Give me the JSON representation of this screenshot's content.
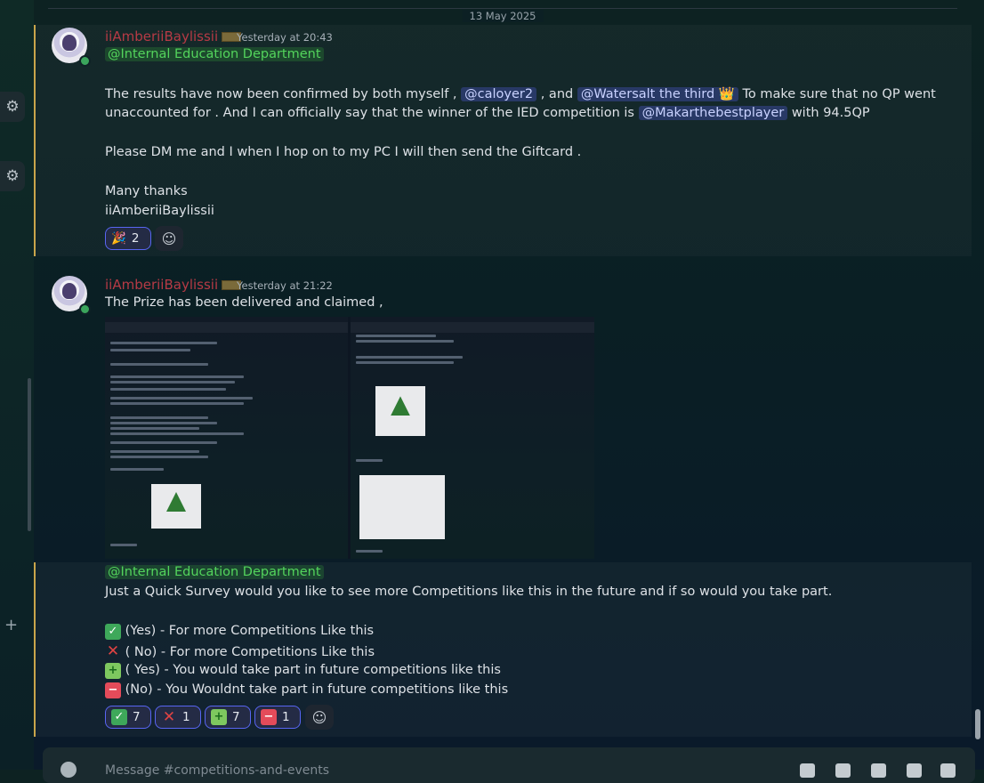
{
  "divider": {
    "date": "13 May 2025"
  },
  "message1": {
    "author": "iiAmberiiBaylissii",
    "timestamp": "Yesterday at 20:43",
    "role_mention": "@Internal Education Department",
    "p1_a": "The results have now been confirmed by both myself ,",
    "mention_a": "@caloyer2",
    "p1_b": ", and",
    "mention_b": "@Watersalt the third",
    "crown": "👑",
    "p1_c": "To make sure that no QP went",
    "p2_a": "unaccounted for . And I can officially say that the winner of the IED competition is",
    "mention_c": "@Makarthebestplayer",
    "p2_b": "with 94.5QP",
    "p3": "Please DM me and I when I hop on to my PC I will then send the Giftcard .",
    "p4": "Many thanks",
    "p5": "iiAmberiiBaylissii",
    "reactions": [
      {
        "emoji": "🎉",
        "count": "2"
      }
    ]
  },
  "message2": {
    "author": "iiAmberiiBaylissii",
    "timestamp": "Yesterday at 21:22",
    "text": "The Prize has been delivered and claimed ,"
  },
  "message3": {
    "role_mention": "@Internal Education Department",
    "line1": "Just a Quick Survey would you like to see more Competitions like this in the future and if so would you take part.",
    "opt1": "(Yes) - For more Competitions Like this",
    "opt2": "( No) - For more Competitions Like this",
    "opt3": "( Yes) - You would take part in future competitions like this",
    "opt4": "(No) - You Wouldnt take part in future competitions like this",
    "reactions": [
      {
        "emoji": "check",
        "count": "7"
      },
      {
        "emoji": "cross",
        "count": "1"
      },
      {
        "emoji": "plus",
        "count": "7"
      },
      {
        "emoji": "minus",
        "count": "1"
      }
    ]
  },
  "composer": {
    "placeholder": "Message #competitions-and-events"
  }
}
